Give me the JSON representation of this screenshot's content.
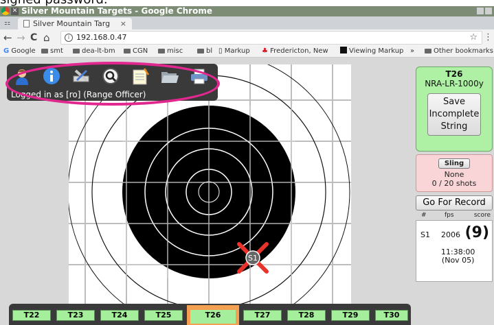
{
  "caption": "signed password.",
  "window": {
    "title": "Silver Mountain Targets - Google Chrome",
    "close_glyph": "✕"
  },
  "tab": {
    "title": "Silver Mountain Targ",
    "close_glyph": "×"
  },
  "address": {
    "url": "192.168.0.47",
    "back_glyph": "←",
    "forward_glyph": "→",
    "reload_glyph": "C",
    "home_glyph": "⌂",
    "star_glyph": "☆",
    "menu_glyph": "⋮"
  },
  "bookmarks": {
    "items": [
      "Google",
      "smt",
      "dea-lt-bm",
      "CGN",
      "misc",
      "bl",
      "Markup",
      "Fredericton, New",
      "Viewing Markup"
    ],
    "overflow": "»",
    "other": "Other bookmarks"
  },
  "toolbar": {
    "icons": [
      "user-icon",
      "info-icon",
      "tools-icon",
      "search-icon",
      "notepad-icon",
      "folder-icon",
      "print-icon"
    ],
    "logged_in_text": "Logged in as [ro] (Range Officer)",
    "highlight_color": "#e0288e"
  },
  "target": {
    "shot_label": "S1",
    "marker_color": "#e8322a"
  },
  "status": {
    "target_id": "T26",
    "match": "NRA-LR-1000y",
    "save_button": "Save Incomplete String",
    "save_lines": [
      "Save",
      "Incomplete",
      "String"
    ],
    "sling_button": "Sling",
    "sling_value": "None",
    "shot_count": "0 / 20 shots",
    "record_button": "Go For Record"
  },
  "shots": {
    "headers": [
      "#",
      "fps",
      "score"
    ],
    "rows": [
      {
        "id": "S1",
        "fps": "2006",
        "score": "(9)",
        "time": "11:38:00",
        "date": "(Nov 05)"
      }
    ]
  },
  "targets": {
    "labels": [
      "T22",
      "T23",
      "T24",
      "T25",
      "T26",
      "T27",
      "T28",
      "T29",
      "T30"
    ],
    "active": "T26",
    "tab_color": "#a5ef9c",
    "active_color": "#f4a052"
  }
}
